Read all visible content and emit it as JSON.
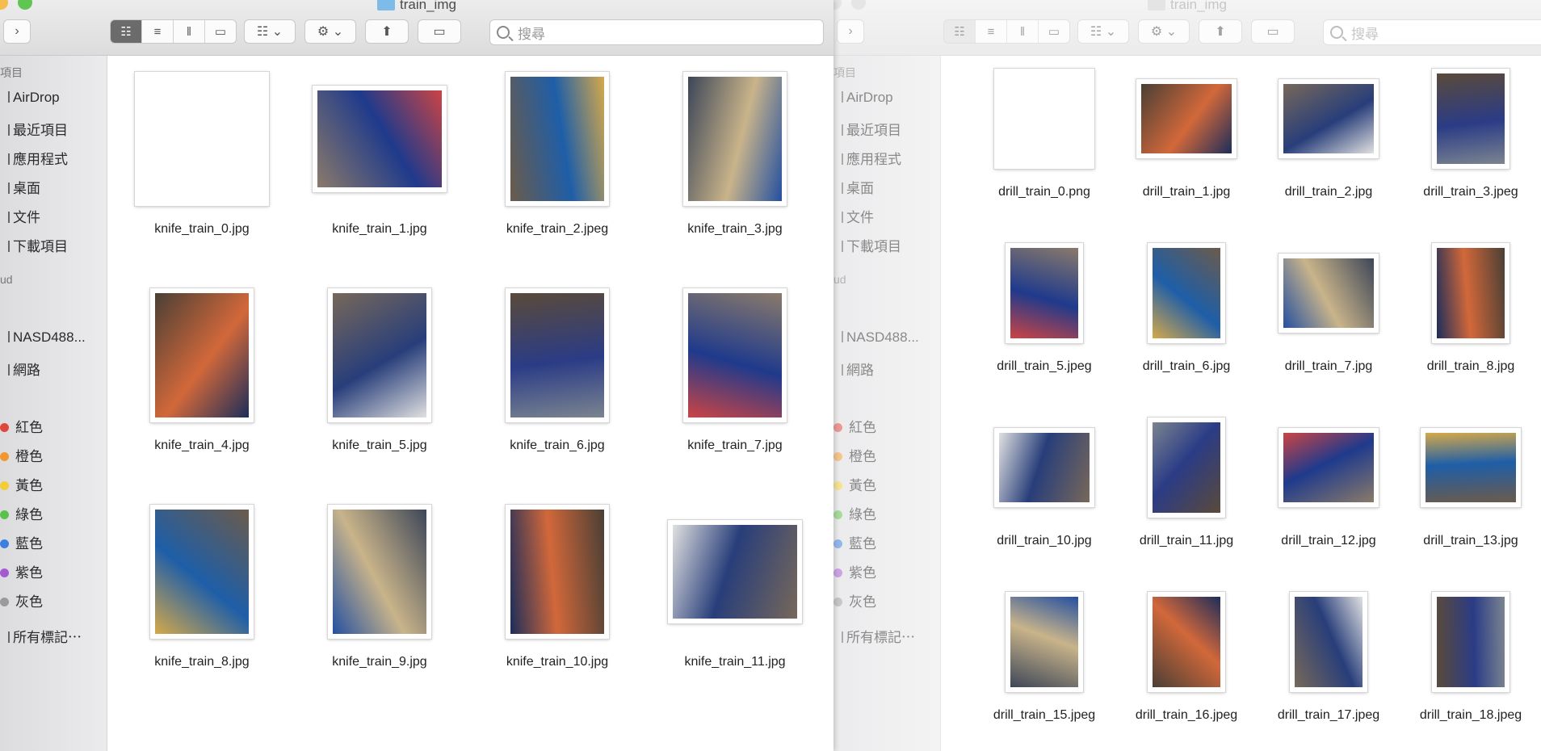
{
  "left_window": {
    "title": "train_img",
    "search_placeholder": "搜尋",
    "icons": {
      "forward": "chevron-right-icon",
      "search": "magnifier-icon",
      "action": "gear-icon",
      "share": "share-icon",
      "tags": "tag-icon"
    },
    "sidebar": {
      "favorites_header": "項目",
      "favorites": [
        "AirDrop",
        "最近項目",
        "應用程式",
        "桌面",
        "文件",
        "下載項目"
      ],
      "icloud_header": "ud",
      "locations": [
        "NASD488...",
        "網路"
      ],
      "tags": [
        {
          "label": "紅色",
          "color": "#e0473c"
        },
        {
          "label": "橙色",
          "color": "#f2962f"
        },
        {
          "label": "黃色",
          "color": "#f2cd33"
        },
        {
          "label": "綠色",
          "color": "#5ac24a"
        },
        {
          "label": "藍色",
          "color": "#3b7fe0"
        },
        {
          "label": "紫色",
          "color": "#a45ad1"
        },
        {
          "label": "灰色",
          "color": "#9a9a9a"
        }
      ],
      "all_tags": "所有標記⋯"
    },
    "files": [
      "knife_train_0.jpg",
      "knife_train_1.jpg",
      "knife_train_2.jpeg",
      "knife_train_3.jpg",
      "knife_train_4.jpg",
      "knife_train_5.jpg",
      "knife_train_6.jpg",
      "knife_train_7.jpg",
      "knife_train_8.jpg",
      "knife_train_9.jpg",
      "knife_train_10.jpg",
      "knife_train_11.jpg"
    ]
  },
  "right_window": {
    "title": "train_img",
    "search_placeholder": "搜尋",
    "sidebar": {
      "favorites_header": "項目",
      "favorites": [
        "AirDrop",
        "最近項目",
        "應用程式",
        "桌面",
        "文件",
        "下載項目"
      ],
      "icloud_header": "ud",
      "locations": [
        "NASD488...",
        "網路"
      ],
      "tags": [
        "紅色",
        "橙色",
        "黃色",
        "綠色",
        "藍色",
        "紫色",
        "灰色"
      ],
      "all_tags": "所有標記⋯"
    },
    "files": [
      "drill_train_0.png",
      "drill_train_1.jpg",
      "drill_train_2.jpg",
      "drill_train_3.jpeg",
      "drill_train_5.jpeg",
      "drill_train_6.jpg",
      "drill_train_7.jpg",
      "drill_train_8.jpg",
      "drill_train_10.jpg",
      "drill_train_11.jpg",
      "drill_train_12.jpg",
      "drill_train_13.jpg",
      "drill_train_15.jpeg",
      "drill_train_16.jpeg",
      "drill_train_17.jpeg",
      "drill_train_18.jpeg"
    ]
  }
}
